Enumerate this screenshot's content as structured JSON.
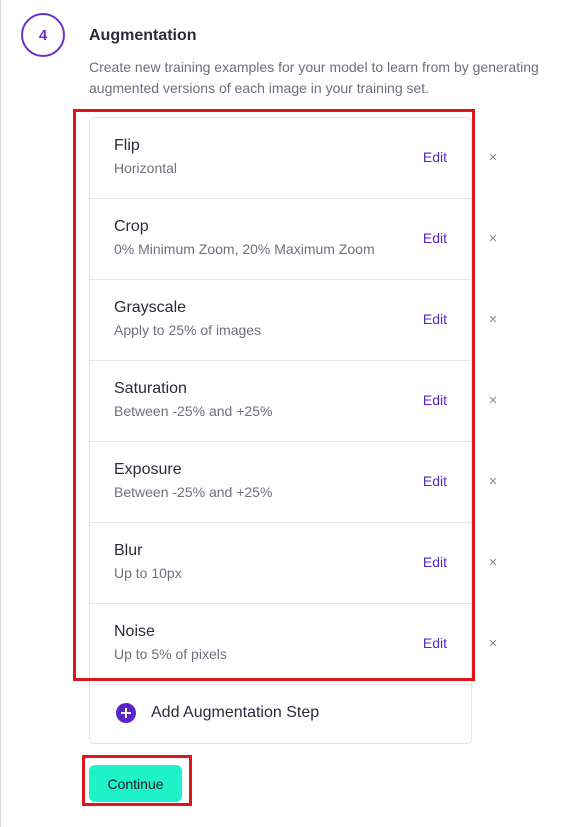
{
  "step": {
    "number": "4",
    "title": "Augmentation",
    "description": "Create new training examples for your model to learn from by generating augmented versions of each image in your training set."
  },
  "augmentations": [
    {
      "name": "Flip",
      "detail": "Horizontal",
      "edit_label": "Edit",
      "remove_glyph": "×"
    },
    {
      "name": "Crop",
      "detail": "0% Minimum Zoom, 20% Maximum Zoom",
      "edit_label": "Edit",
      "remove_glyph": "×"
    },
    {
      "name": "Grayscale",
      "detail": "Apply to 25% of images",
      "edit_label": "Edit",
      "remove_glyph": "×"
    },
    {
      "name": "Saturation",
      "detail": "Between -25% and +25%",
      "edit_label": "Edit",
      "remove_glyph": "×"
    },
    {
      "name": "Exposure",
      "detail": "Between -25% and +25%",
      "edit_label": "Edit",
      "remove_glyph": "×"
    },
    {
      "name": "Blur",
      "detail": "Up to 10px",
      "edit_label": "Edit",
      "remove_glyph": "×"
    },
    {
      "name": "Noise",
      "detail": "Up to 5% of pixels",
      "edit_label": "Edit",
      "remove_glyph": "×"
    }
  ],
  "add_step": {
    "label": "Add Augmentation Step",
    "icon": "plus-circle-icon"
  },
  "continue_button": {
    "label": "Continue"
  },
  "colors": {
    "accent": "#5b24c6",
    "continue_bg": "#1ef2c8",
    "highlight": "#e0151b"
  }
}
